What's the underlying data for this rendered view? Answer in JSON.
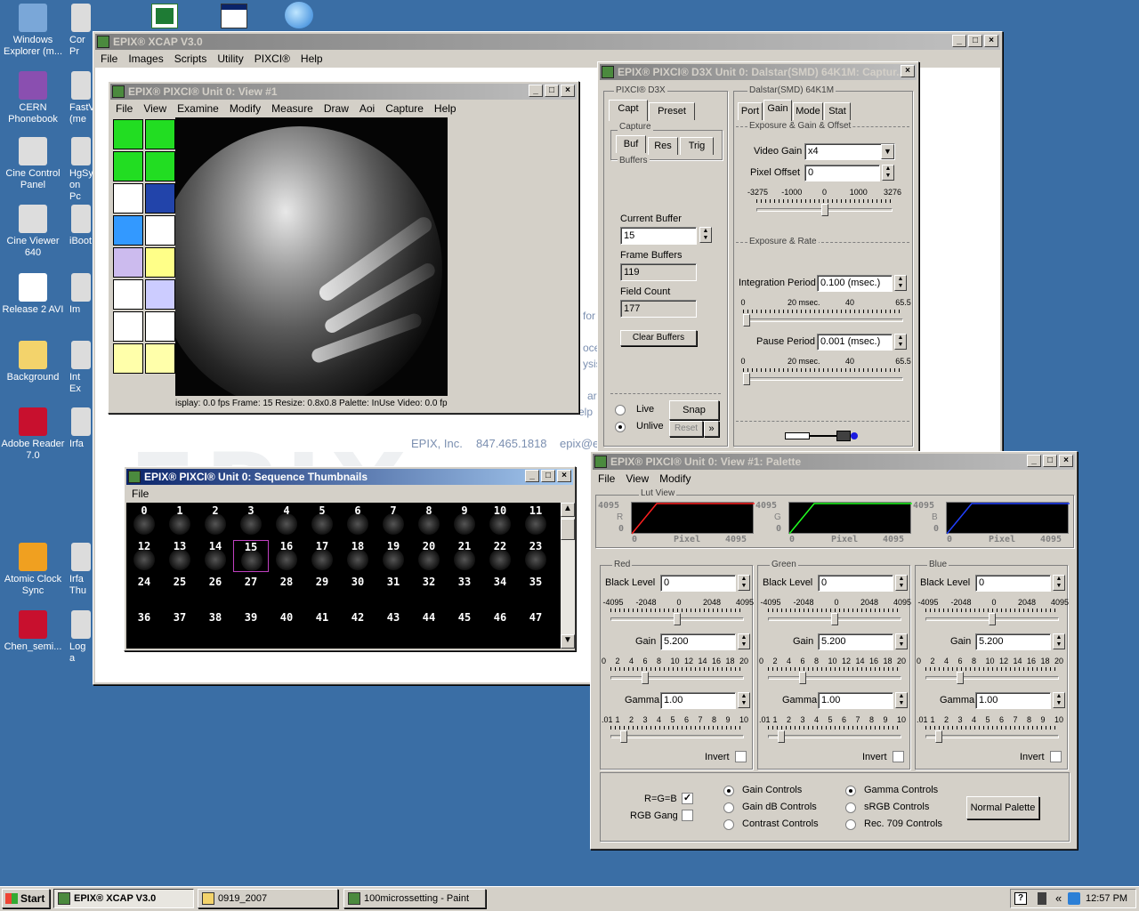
{
  "desktop": {
    "icons_col1": [
      {
        "label": "Windows Explorer (m...",
        "icon": "explorer-icon",
        "color": "#7aa7d8"
      },
      {
        "label": "CERN Phonebook",
        "icon": "phonebook-icon",
        "color": "#8a4fb0"
      },
      {
        "label": "Cine Control Panel",
        "icon": "cine-control-icon",
        "color": "#dddddd"
      },
      {
        "label": "Cine Viewer 640",
        "icon": "cine-viewer-icon",
        "color": "#dddddd"
      },
      {
        "label": "Release 2 AVI",
        "icon": "avi-icon",
        "color": "#ffffff"
      },
      {
        "label": "Background",
        "icon": "folder-icon",
        "color": "#f3d36b"
      },
      {
        "label": "Adobe Reader 7.0",
        "icon": "adobe-reader-icon",
        "color": "#c8102e"
      },
      {
        "label": "Atomic Clock Sync",
        "icon": "atomic-clock-icon",
        "color": "#f0a020"
      },
      {
        "label": "Chen_semi...",
        "icon": "pdf-icon",
        "color": "#c8102e"
      }
    ],
    "icons_col2": [
      {
        "label": "Cor Pr",
        "icon": "command-prompt-icon"
      },
      {
        "label": "FastV (me",
        "icon": "fastv-icon"
      },
      {
        "label": "HgSy on Pc",
        "icon": "hgsync-icon"
      },
      {
        "label": "iBoot",
        "icon": "iboot-icon"
      },
      {
        "label": "Im",
        "icon": "im-icon"
      },
      {
        "label": "Int Ex",
        "icon": "ie-icon"
      },
      {
        "label": "Irfa",
        "icon": "irfanview-icon"
      },
      {
        "label": "Irfa Thu",
        "icon": "irfanview-thumbs-icon"
      },
      {
        "label": "Log a",
        "icon": "log-icon"
      }
    ],
    "top_icons": [
      "excel-icon",
      "window-app-icon",
      "network-icon"
    ]
  },
  "main_window": {
    "title": "EPIX® XCAP V3.0",
    "menu": [
      "File",
      "Images",
      "Scripts",
      "Utility",
      "PIXCI®",
      "Help"
    ],
    "background_text": {
      "company": "EPIX, Inc.",
      "phone": "847.465.1818",
      "email": "epix@e",
      "frag1": "for",
      "frag2": "oce",
      "frag3": "ysis",
      "frag4": "ar",
      "frag5": "elp"
    }
  },
  "view_window": {
    "title": "EPIX® PIXCI® Unit 0: View #1",
    "menu": [
      "File",
      "View",
      "Examine",
      "Modify",
      "Measure",
      "Draw",
      "Aoi",
      "Capture",
      "Help"
    ],
    "status": "isplay: 0.0 fps   Frame: 15   Resize: 0.8x0.8   Palette: InUse   Video: 0.0 fp",
    "tools": [
      "arrow-down-left-icon",
      "arrow-down-right-icon",
      "arrow-right-icon",
      "arrow-left-icon",
      "capture-tool-icon",
      "probe-tool-icon",
      "faces-icon",
      "palette-icon",
      "draw-shape-icon",
      "crosshair-icon",
      "image-tool-icon",
      "grid-icon",
      "graph-icon",
      "histogram-icon",
      "video-camera-icon",
      "film-icon"
    ]
  },
  "capture_window": {
    "title": "EPIX® PIXCI® D3X Unit 0: Dalstar(SMD) 64K1M: Captur...",
    "left_group": "PIXCI® D3X",
    "tabs": [
      "Capt",
      "Preset"
    ],
    "capture_group": "Capture",
    "subtabs": [
      "Buf",
      "Res",
      "Trig"
    ],
    "buffers_group": "Buffers",
    "current_buffer_label": "Current Buffer",
    "current_buffer": "15",
    "frame_buffers_label": "Frame Buffers",
    "frame_buffers": "119",
    "field_count_label": "Field Count",
    "field_count": "177",
    "clear_buffers": "Clear Buffers",
    "live": "Live",
    "unlive": "Unlive",
    "snap": "Snap",
    "reset": "Reset",
    "more": "»",
    "right_group": "Dalstar(SMD) 64K1M",
    "rtabs": [
      "Port",
      "Gain",
      "Mode",
      "Stat"
    ],
    "exp_group": "Exposure & Gain & Offset",
    "video_gain_label": "Video Gain",
    "video_gain": "x4",
    "pixel_offset_label": "Pixel Offset",
    "pixel_offset": "0",
    "offset_scale": [
      "-3275",
      "-1000",
      "0",
      "1000",
      "3276"
    ],
    "offset_level": 0.5,
    "rate_group": "Exposure & Rate",
    "integration_label": "Integration Period",
    "integration": "0.100 (msec.)",
    "pause_label": "Pause Period",
    "pause": "0.001 (msec.)",
    "period_scale": [
      "0",
      "20 msec.",
      "40",
      "65.5"
    ],
    "integration_level": 0.0,
    "pause_level": 0.0
  },
  "thumbs_window": {
    "title": "EPIX® PIXCI® Unit 0: Sequence Thumbnails",
    "menu": [
      "File"
    ],
    "frames": [
      "0",
      "1",
      "2",
      "3",
      "4",
      "5",
      "6",
      "7",
      "8",
      "9",
      "10",
      "11",
      "12",
      "13",
      "14",
      "15",
      "16",
      "17",
      "18",
      "19",
      "20",
      "21",
      "22",
      "23",
      "24",
      "25",
      "26",
      "27",
      "28",
      "29",
      "30",
      "31",
      "32",
      "33",
      "34",
      "35",
      "36",
      "37",
      "38",
      "39",
      "40",
      "41",
      "42",
      "43",
      "44",
      "45",
      "46",
      "47"
    ],
    "selected": "15"
  },
  "palette_window": {
    "title": "EPIX® PIXCI® Unit 0: View #1: Palette",
    "menu": [
      "File",
      "View",
      "Modify"
    ],
    "lut_group": "Lut View",
    "lut_max": "4095",
    "lut_min": "0",
    "lut_axis": "Pixel",
    "lut_channels": [
      {
        "letter": "R",
        "color": "#ff2020"
      },
      {
        "letter": "G",
        "color": "#20ff20"
      },
      {
        "letter": "B",
        "color": "#2040ff"
      }
    ],
    "channels": [
      {
        "name": "Red",
        "black_level": "0",
        "gain": "5.200",
        "gamma": "1.00"
      },
      {
        "name": "Green",
        "black_level": "0",
        "gain": "5.200",
        "gamma": "1.00"
      },
      {
        "name": "Blue",
        "black_level": "0",
        "gain": "5.200",
        "gamma": "1.00"
      }
    ],
    "black_level_label": "Black Level",
    "gain_label": "Gain",
    "gamma_label": "Gamma",
    "invert_label": "Invert",
    "bl_scale": [
      "-4095",
      "-2048",
      "0",
      "2048",
      "4095"
    ],
    "gain_scale": [
      "0",
      "2",
      "4",
      "6",
      "8",
      "10",
      "12",
      "14",
      "16",
      "18",
      "20"
    ],
    "gamma_scale": [
      ".01",
      "1",
      "2",
      "3",
      "4",
      "5",
      "6",
      "7",
      "8",
      "9",
      "10"
    ],
    "black_level_fraction": 0.5,
    "gain_fraction": 0.26,
    "gamma_fraction": 0.1,
    "rgb_equal": "R=G=B",
    "rgb_gang": "RGB Gang",
    "gain_options": [
      "Gain Controls",
      "Gain dB Controls",
      "Contrast Controls"
    ],
    "gamma_options": [
      "Gamma Controls",
      "sRGB Controls",
      "Rec. 709 Controls"
    ],
    "normal_palette": "Normal Palette"
  },
  "taskbar": {
    "start": "Start",
    "items": [
      "EPIX® XCAP V3.0",
      "0919_2007",
      "100microssetting - Paint"
    ],
    "clock": "12:57 PM",
    "chevron": "«"
  }
}
